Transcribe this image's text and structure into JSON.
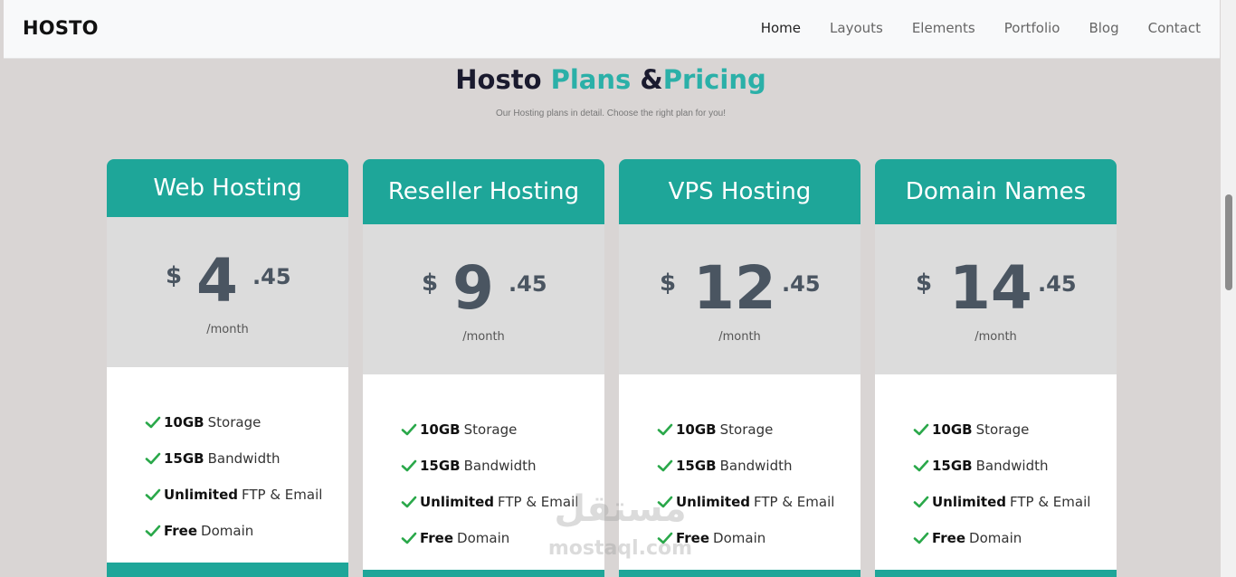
{
  "navbar": {
    "brand": "HOSTO",
    "links": [
      "Home",
      "Layouts",
      "Elements",
      "Portfolio",
      "Blog",
      "Contact"
    ],
    "active": "Home"
  },
  "section": {
    "title_part1": "Hosto",
    "title_part2": "Plans",
    "title_part3": "&",
    "title_part4": "Pricing",
    "subtitle": "Our Hosting plans in detail. Choose the right plan for you!"
  },
  "plans": [
    {
      "name": "Web Hosting",
      "currency": "$",
      "amount": "4",
      "cents": ".45",
      "period": "/month",
      "features": [
        {
          "bold": "10GB",
          "text": "Storage"
        },
        {
          "bold": "15GB",
          "text": "Bandwidth"
        },
        {
          "bold": "Unlimited",
          "text": "FTP & Email"
        },
        {
          "bold": "Free",
          "text": "Domain"
        }
      ]
    },
    {
      "name": "Reseller Hosting",
      "currency": "$",
      "amount": "9",
      "cents": ".45",
      "period": "/month",
      "features": [
        {
          "bold": "10GB",
          "text": "Storage"
        },
        {
          "bold": "15GB",
          "text": "Bandwidth"
        },
        {
          "bold": "Unlimited",
          "text": "FTP & Email"
        },
        {
          "bold": "Free",
          "text": "Domain"
        }
      ]
    },
    {
      "name": "VPS Hosting",
      "currency": "$",
      "amount": "12",
      "cents": ".45",
      "period": "/month",
      "features": [
        {
          "bold": "10GB",
          "text": "Storage"
        },
        {
          "bold": "15GB",
          "text": "Bandwidth"
        },
        {
          "bold": "Unlimited",
          "text": "FTP & Email"
        },
        {
          "bold": "Free",
          "text": "Domain"
        }
      ]
    },
    {
      "name": "Domain Names",
      "currency": "$",
      "amount": "14",
      "cents": ".45",
      "period": "/month",
      "features": [
        {
          "bold": "10GB",
          "text": "Storage"
        },
        {
          "bold": "15GB",
          "text": "Bandwidth"
        },
        {
          "bold": "Unlimited",
          "text": "FTP & Email"
        },
        {
          "bold": "Free",
          "text": "Domain"
        }
      ]
    }
  ],
  "watermark": {
    "arabic": "مستقل",
    "latin": "mostaql.com"
  },
  "colors": {
    "accent": "#1ea699",
    "title_accent": "#2bb0a8",
    "price_text": "#4a5561",
    "check": "#2aa84a",
    "background": "#d9d5d4"
  }
}
